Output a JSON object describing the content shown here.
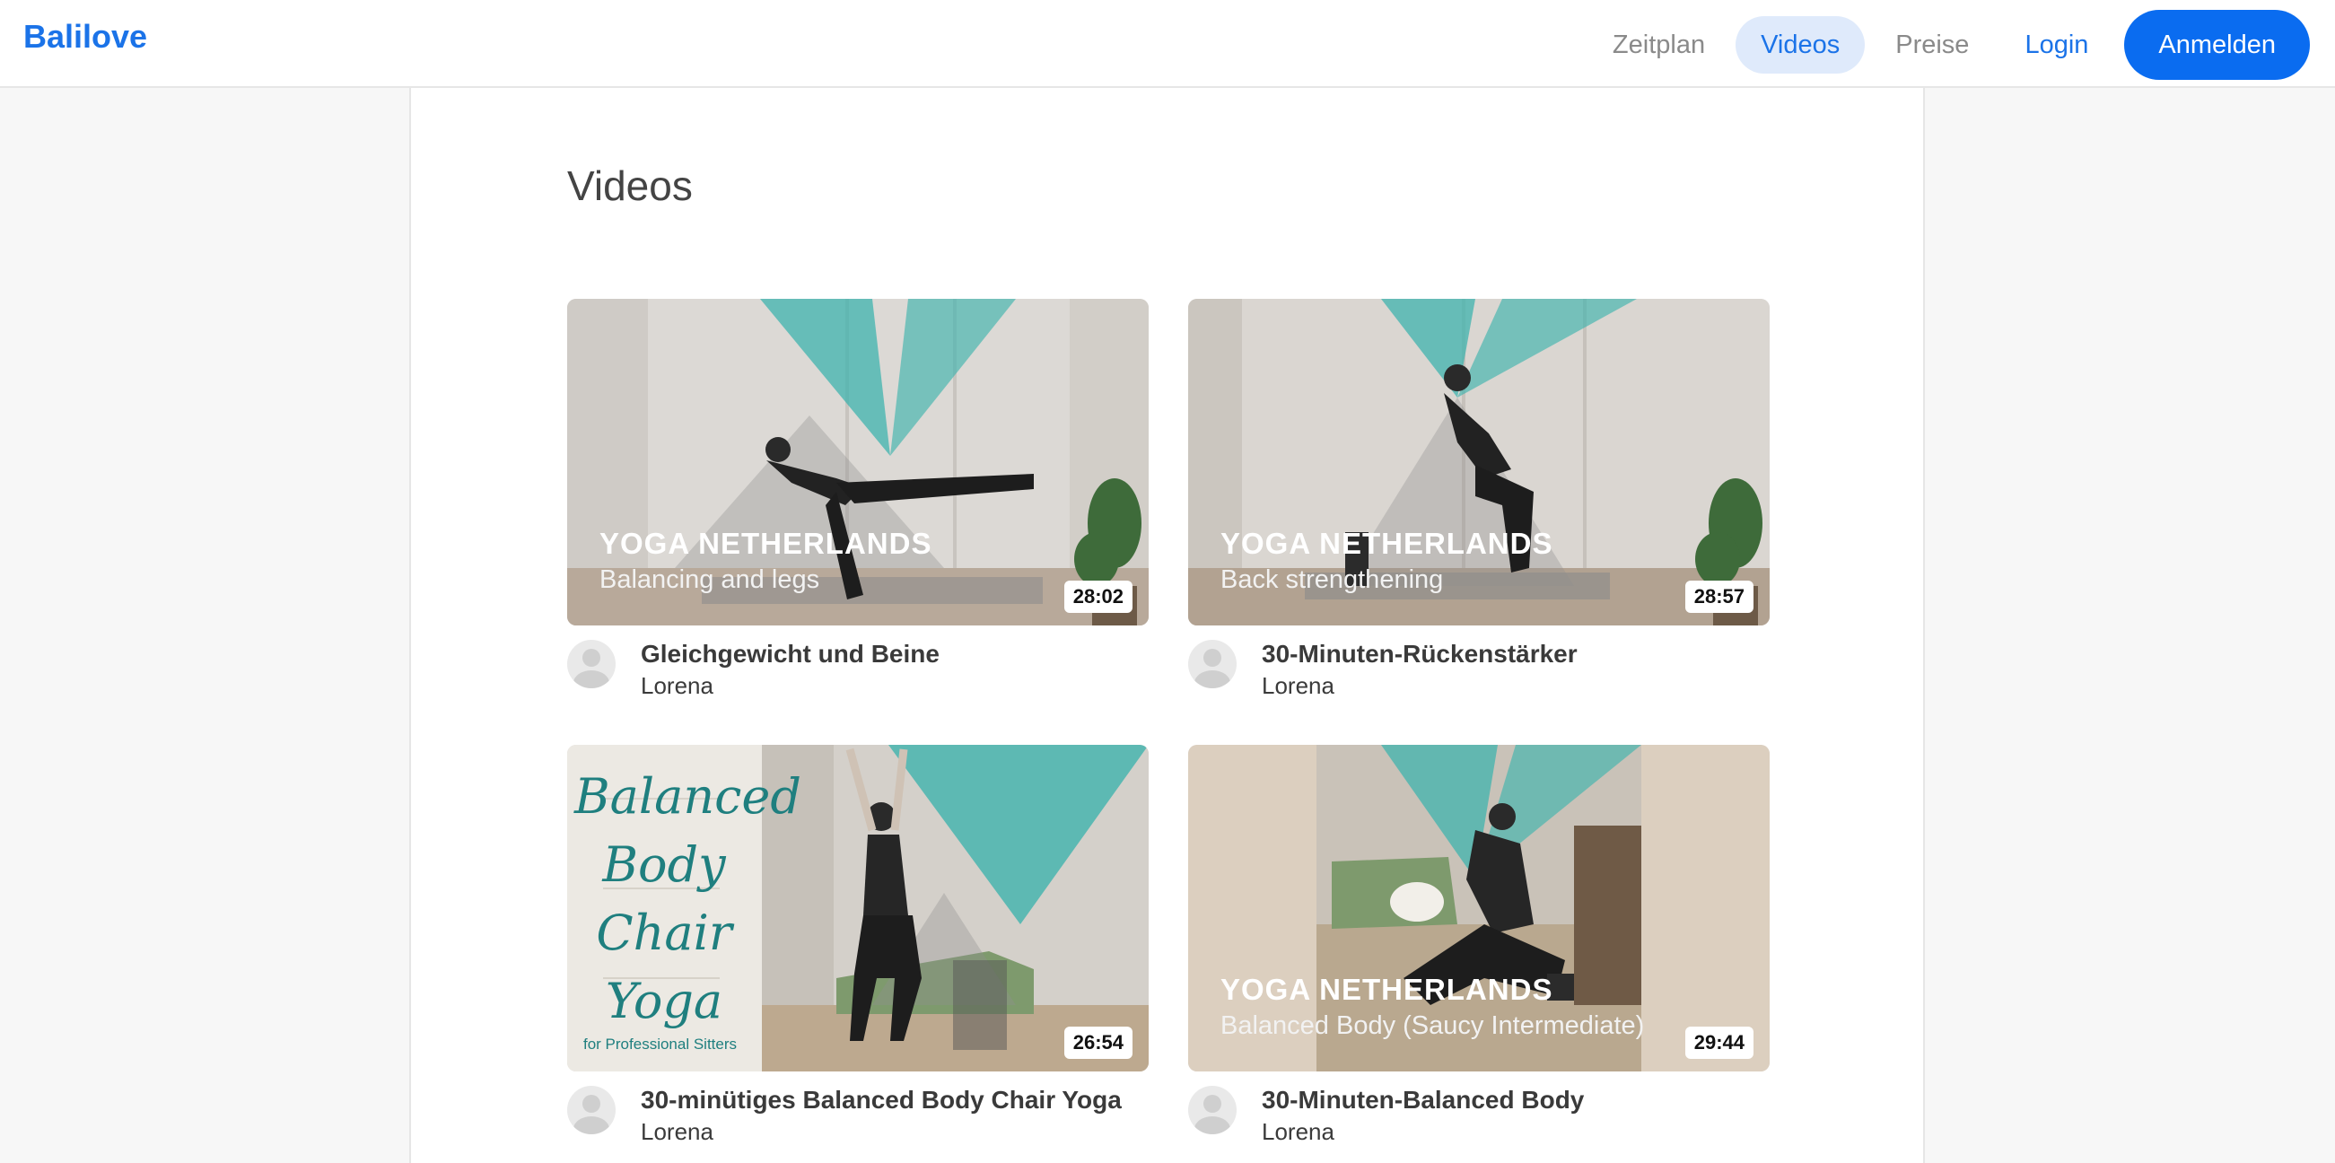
{
  "header": {
    "brand": "Balilove",
    "nav": {
      "schedule": "Zeitplan",
      "videos": "Videos",
      "prices": "Preise",
      "login": "Login",
      "signup": "Anmelden"
    }
  },
  "page": {
    "title": "Videos"
  },
  "videos": [
    {
      "overlay_title": "YOGA NETHERLANDS",
      "overlay_subtitle": "Balancing and legs",
      "duration": "28:02",
      "title": "Gleichgewicht und Beine",
      "author": "Lorena"
    },
    {
      "overlay_title": "YOGA NETHERLANDS",
      "overlay_subtitle": "Back strengthening",
      "duration": "28:57",
      "title": "30-Minuten-Rückenstärker",
      "author": "Lorena"
    },
    {
      "overlay_lines": [
        "Balanced",
        "Body",
        "Chair",
        "Yoga"
      ],
      "overlay_small": "for Professional Sitters",
      "duration": "26:54",
      "title": "30-minütiges Balanced Body Chair Yoga",
      "author": "Lorena"
    },
    {
      "overlay_title": "YOGA NETHERLANDS",
      "overlay_subtitle": "Balanced Body (Saucy Intermediate)",
      "duration": "29:44",
      "title": "30-Minuten-Balanced Body",
      "author": "Lorena"
    }
  ],
  "colors": {
    "brand": "#1b73e8",
    "cta": "#0a6cf0",
    "accent_teal": "#3fb3ad"
  }
}
